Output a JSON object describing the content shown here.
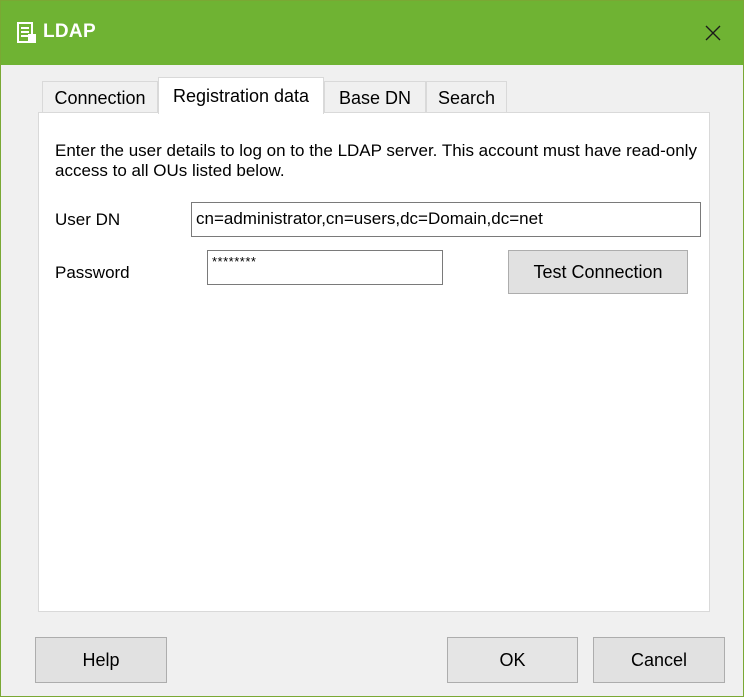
{
  "window": {
    "title": "LDAP"
  },
  "tabs": [
    {
      "label": "Connection"
    },
    {
      "label": "Registration data"
    },
    {
      "label": "Base DN"
    },
    {
      "label": "Search"
    }
  ],
  "form": {
    "description": "Enter the user details to log on to the LDAP server. This account must have read-only access to all OUs listed below.",
    "user_dn_label": "User DN",
    "user_dn_value": "cn=administrator,cn=users,dc=Domain,dc=net",
    "password_label": "Password",
    "password_value": "********",
    "test_connection_label": "Test Connection"
  },
  "footer": {
    "help_label": "Help",
    "ok_label": "OK",
    "cancel_label": "Cancel"
  },
  "colors": {
    "title_bar": "#6fb333",
    "window_bg": "#f0f0f0"
  },
  "icons": {
    "window_icon": "document-list-icon",
    "close_icon": "close-icon"
  }
}
